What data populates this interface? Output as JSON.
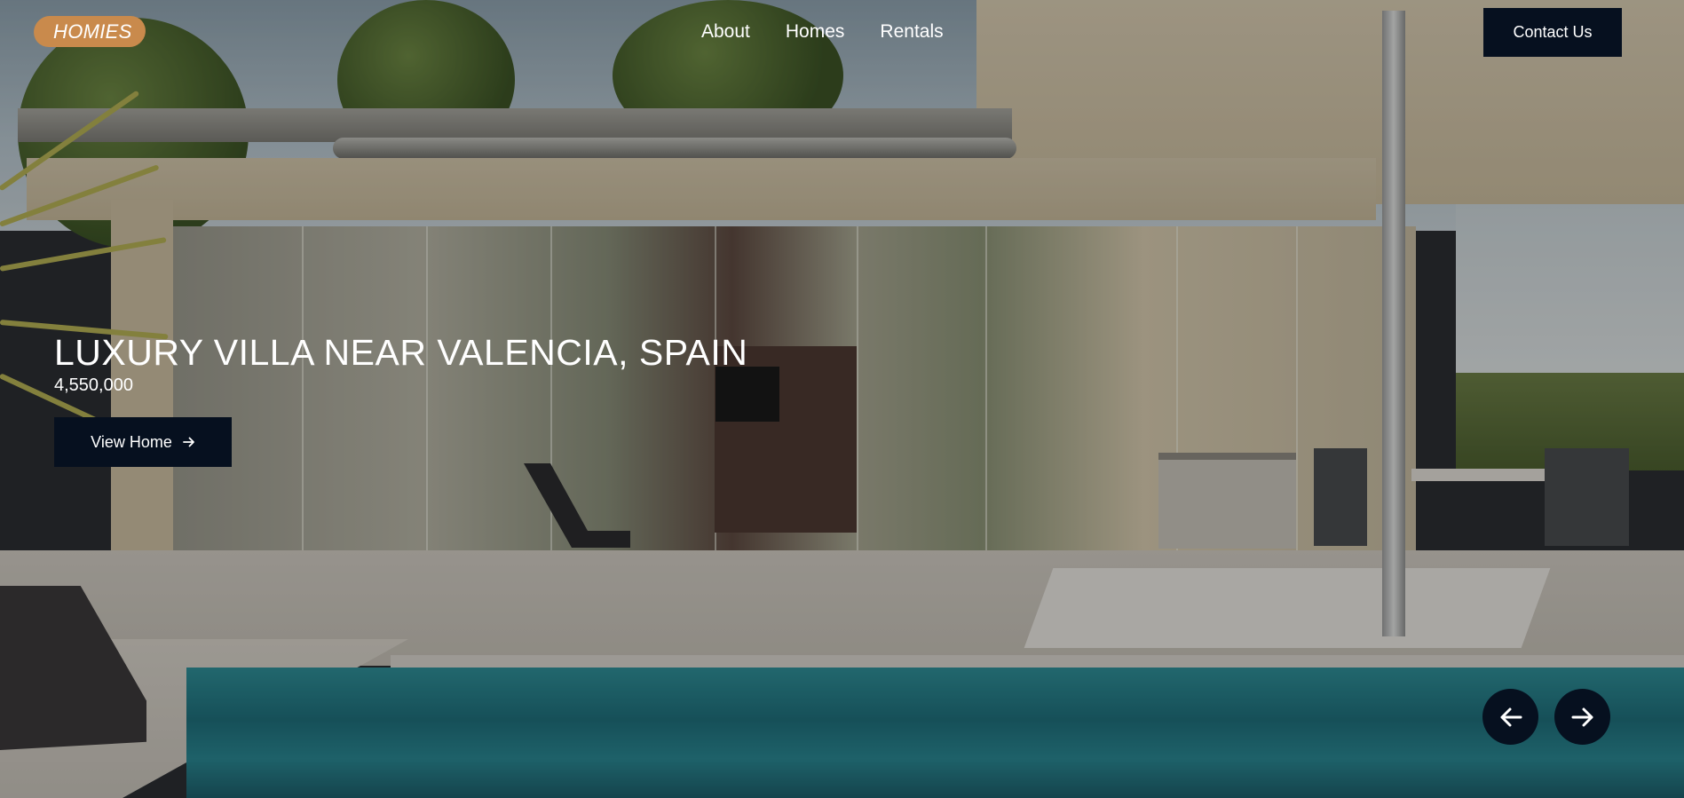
{
  "header": {
    "logo_text": "HOMIES",
    "nav": [
      {
        "label": "About"
      },
      {
        "label": "Homes"
      },
      {
        "label": "Rentals"
      }
    ],
    "contact_label": "Contact Us"
  },
  "hero": {
    "title": "LUXURY VILLA NEAR VALENCIA, SPAIN",
    "price": "4,550,000",
    "cta_label": "View Home",
    "cta_icon": "arrow-right-icon"
  },
  "carousel": {
    "prev_icon": "arrow-left-icon",
    "next_icon": "arrow-right-icon"
  },
  "colors": {
    "logo_accent": "#c98a4c",
    "button_dark": "#06101f",
    "text": "#ffffff"
  }
}
